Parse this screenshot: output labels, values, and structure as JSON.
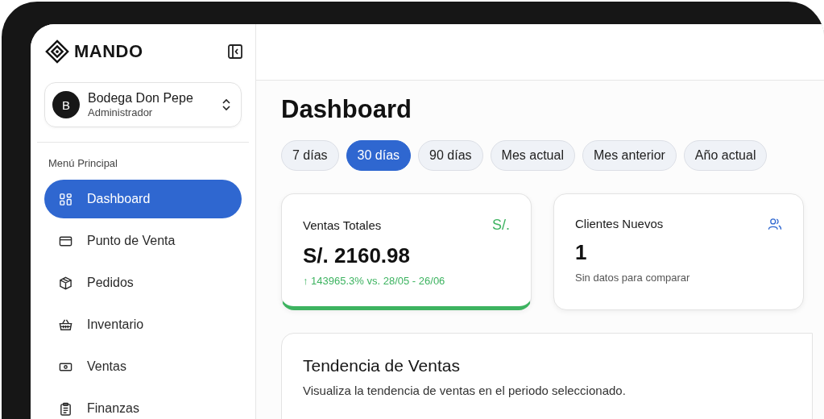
{
  "brand": {
    "name": "MANDO"
  },
  "account": {
    "initial": "B",
    "name": "Bodega Don Pepe",
    "role": "Administrador"
  },
  "sidebar": {
    "section": "Menú Principal",
    "items": [
      {
        "label": "Dashboard",
        "kind": "grid",
        "selected": true
      },
      {
        "label": "Punto de Venta",
        "kind": "card",
        "selected": false
      },
      {
        "label": "Pedidos",
        "kind": "box",
        "selected": false
      },
      {
        "label": "Inventario",
        "kind": "basket",
        "selected": false
      },
      {
        "label": "Ventas",
        "kind": "cash",
        "selected": false
      },
      {
        "label": "Finanzas",
        "kind": "clipboard",
        "selected": false
      }
    ]
  },
  "page": {
    "title": "Dashboard"
  },
  "periods": [
    {
      "label": "7 días",
      "selected": false
    },
    {
      "label": "30 días",
      "selected": true
    },
    {
      "label": "90 días",
      "selected": false
    },
    {
      "label": "Mes actual",
      "selected": false
    },
    {
      "label": "Mes anterior",
      "selected": false
    },
    {
      "label": "Año actual",
      "selected": false
    }
  ],
  "cards": [
    {
      "kind": "currency",
      "title": "Ventas Totales",
      "symbol": "S/.",
      "value": "S/. 2160.98",
      "change": "↑ 143965.3% vs. 28/05 - 26/06",
      "color": "#3db360"
    },
    {
      "kind": "users",
      "title": "Clientes Nuevos",
      "value": "1",
      "note": "Sin datos para comparar"
    }
  ],
  "trend": {
    "title": "Tendencia de Ventas",
    "subtitle": "Visualiza la tendencia de ventas en el periodo seleccionado."
  }
}
